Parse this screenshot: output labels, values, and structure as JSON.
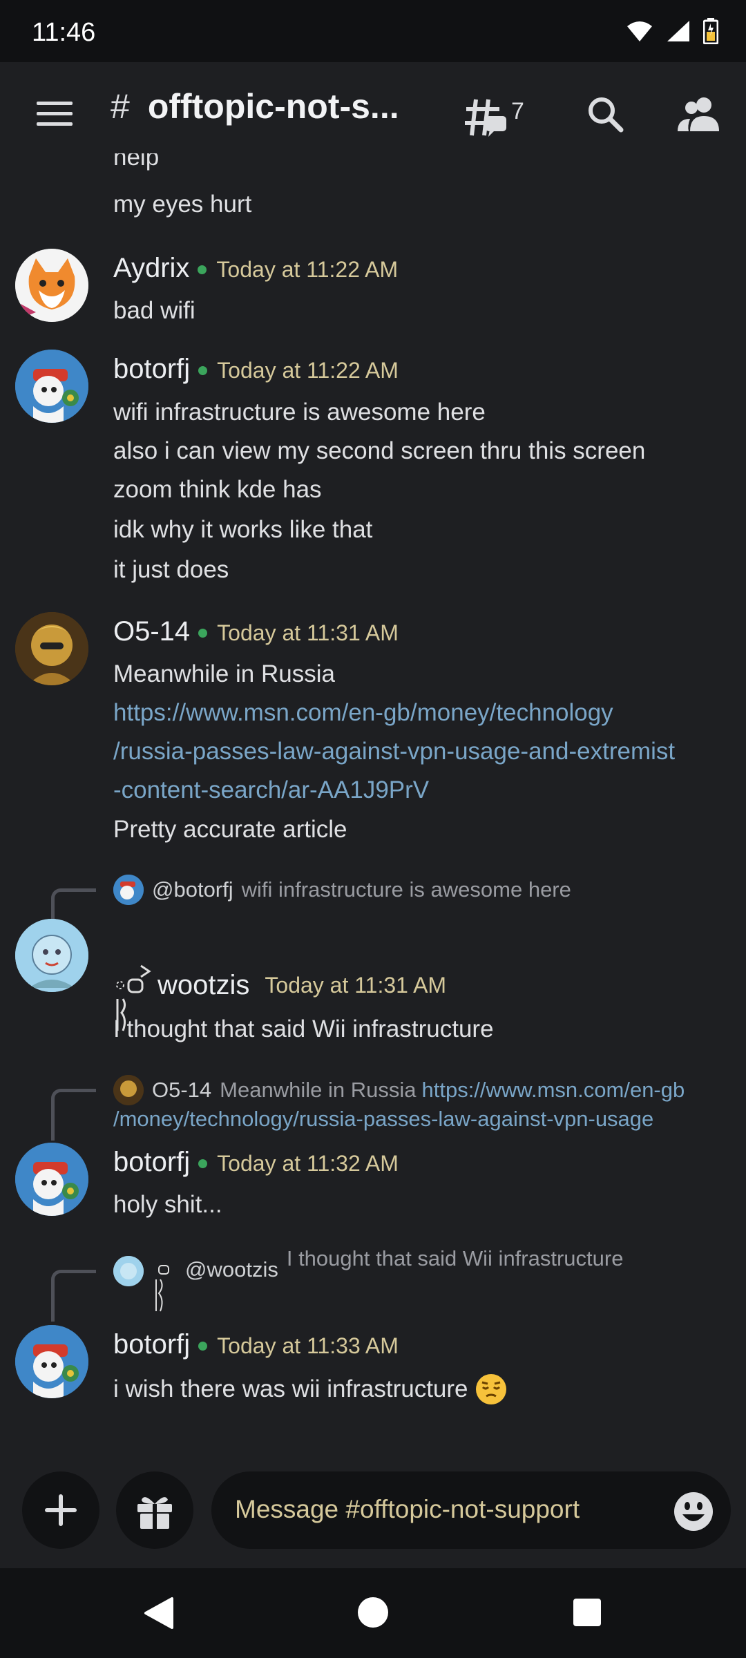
{
  "status_bar": {
    "time": "11:46"
  },
  "header": {
    "channel_name": "offtopic-not-s...",
    "threads_count": "7"
  },
  "messages": [
    {
      "lines": [
        "help",
        "my eyes hurt"
      ]
    },
    {
      "author": "Aydrix",
      "time": "Today at 11:22 AM",
      "lines": [
        "bad wifi"
      ]
    },
    {
      "author": "botorfj",
      "time": "Today at 11:22 AM",
      "lines": [
        "wifi infrastructure is awesome here",
        "also i can view my second screen thru this screen",
        "zoom think kde has",
        "idk why it works like that",
        "it just does"
      ]
    },
    {
      "author": "O5-14",
      "time": "Today at 11:31 AM",
      "lines": [
        "Meanwhile in Russia"
      ],
      "link_lines": [
        "https://www.msn.com/en-gb/money/technology",
        "/russia-passes-law-against-vpn-usage-and-extremist",
        "-content-search/ar-AA1J9PrV"
      ],
      "after_link": "Pretty accurate article"
    },
    {
      "reply_to": {
        "name": "@botorfj",
        "text": "wifi infrastructure is awesome here"
      },
      "author": "wootzis",
      "time": "Today at 11:31 AM",
      "lines": [
        "I thought that said Wii infrastructure"
      ]
    },
    {
      "reply_to": {
        "name": "O5-14",
        "text": "Meanwhile in Russia",
        "link_a": "https://www.msn.com/en-gb",
        "link_b": "/money/technology/russia-passes-law-against-vpn-usage"
      },
      "author": "botorfj",
      "time": "Today at 11:32 AM",
      "lines": [
        "holy shit..."
      ]
    },
    {
      "reply_to": {
        "name": "@wootzis",
        "text": "I thought that said Wii infrastructure"
      },
      "author": "botorfj",
      "time": "Today at 11:33 AM",
      "lines": [
        "i wish there was wii infrastructure"
      ]
    }
  ],
  "composer": {
    "placeholder": "Message #offtopic-not-support"
  },
  "icons": {
    "menu": "hamburger-icon",
    "channel": "hash-icon",
    "threads": "threads-icon",
    "search": "search-icon",
    "members": "members-icon",
    "add": "plus-icon",
    "gift": "gift-icon",
    "emoji": "emoji-icon"
  },
  "colors": {
    "background": "#1e1f22",
    "online": "#3ba55c",
    "timestamp": "#d6c99b",
    "link": "#7aa6c8"
  }
}
